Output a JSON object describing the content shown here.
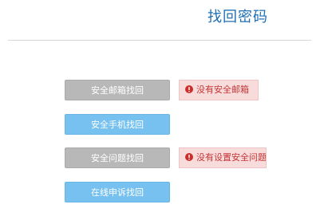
{
  "page": {
    "title": "找回密码"
  },
  "options": [
    {
      "label": "安全邮箱找回",
      "state": "disabled"
    },
    {
      "label": "安全手机找回",
      "state": "enabled"
    },
    {
      "label": "安全问题找回",
      "state": "disabled"
    },
    {
      "label": "在线申诉找回",
      "state": "enabled"
    }
  ],
  "tips": {
    "email": "没有安全邮箱",
    "question": "没有设置安全问题",
    "icon": "error-circle-icon"
  },
  "colors": {
    "title": "#1f6fb5",
    "button_disabled": "#b8b8b8",
    "button_enabled": "#76c1ef",
    "tip_background": "#f8dcdc",
    "tip_text": "#c33636"
  }
}
